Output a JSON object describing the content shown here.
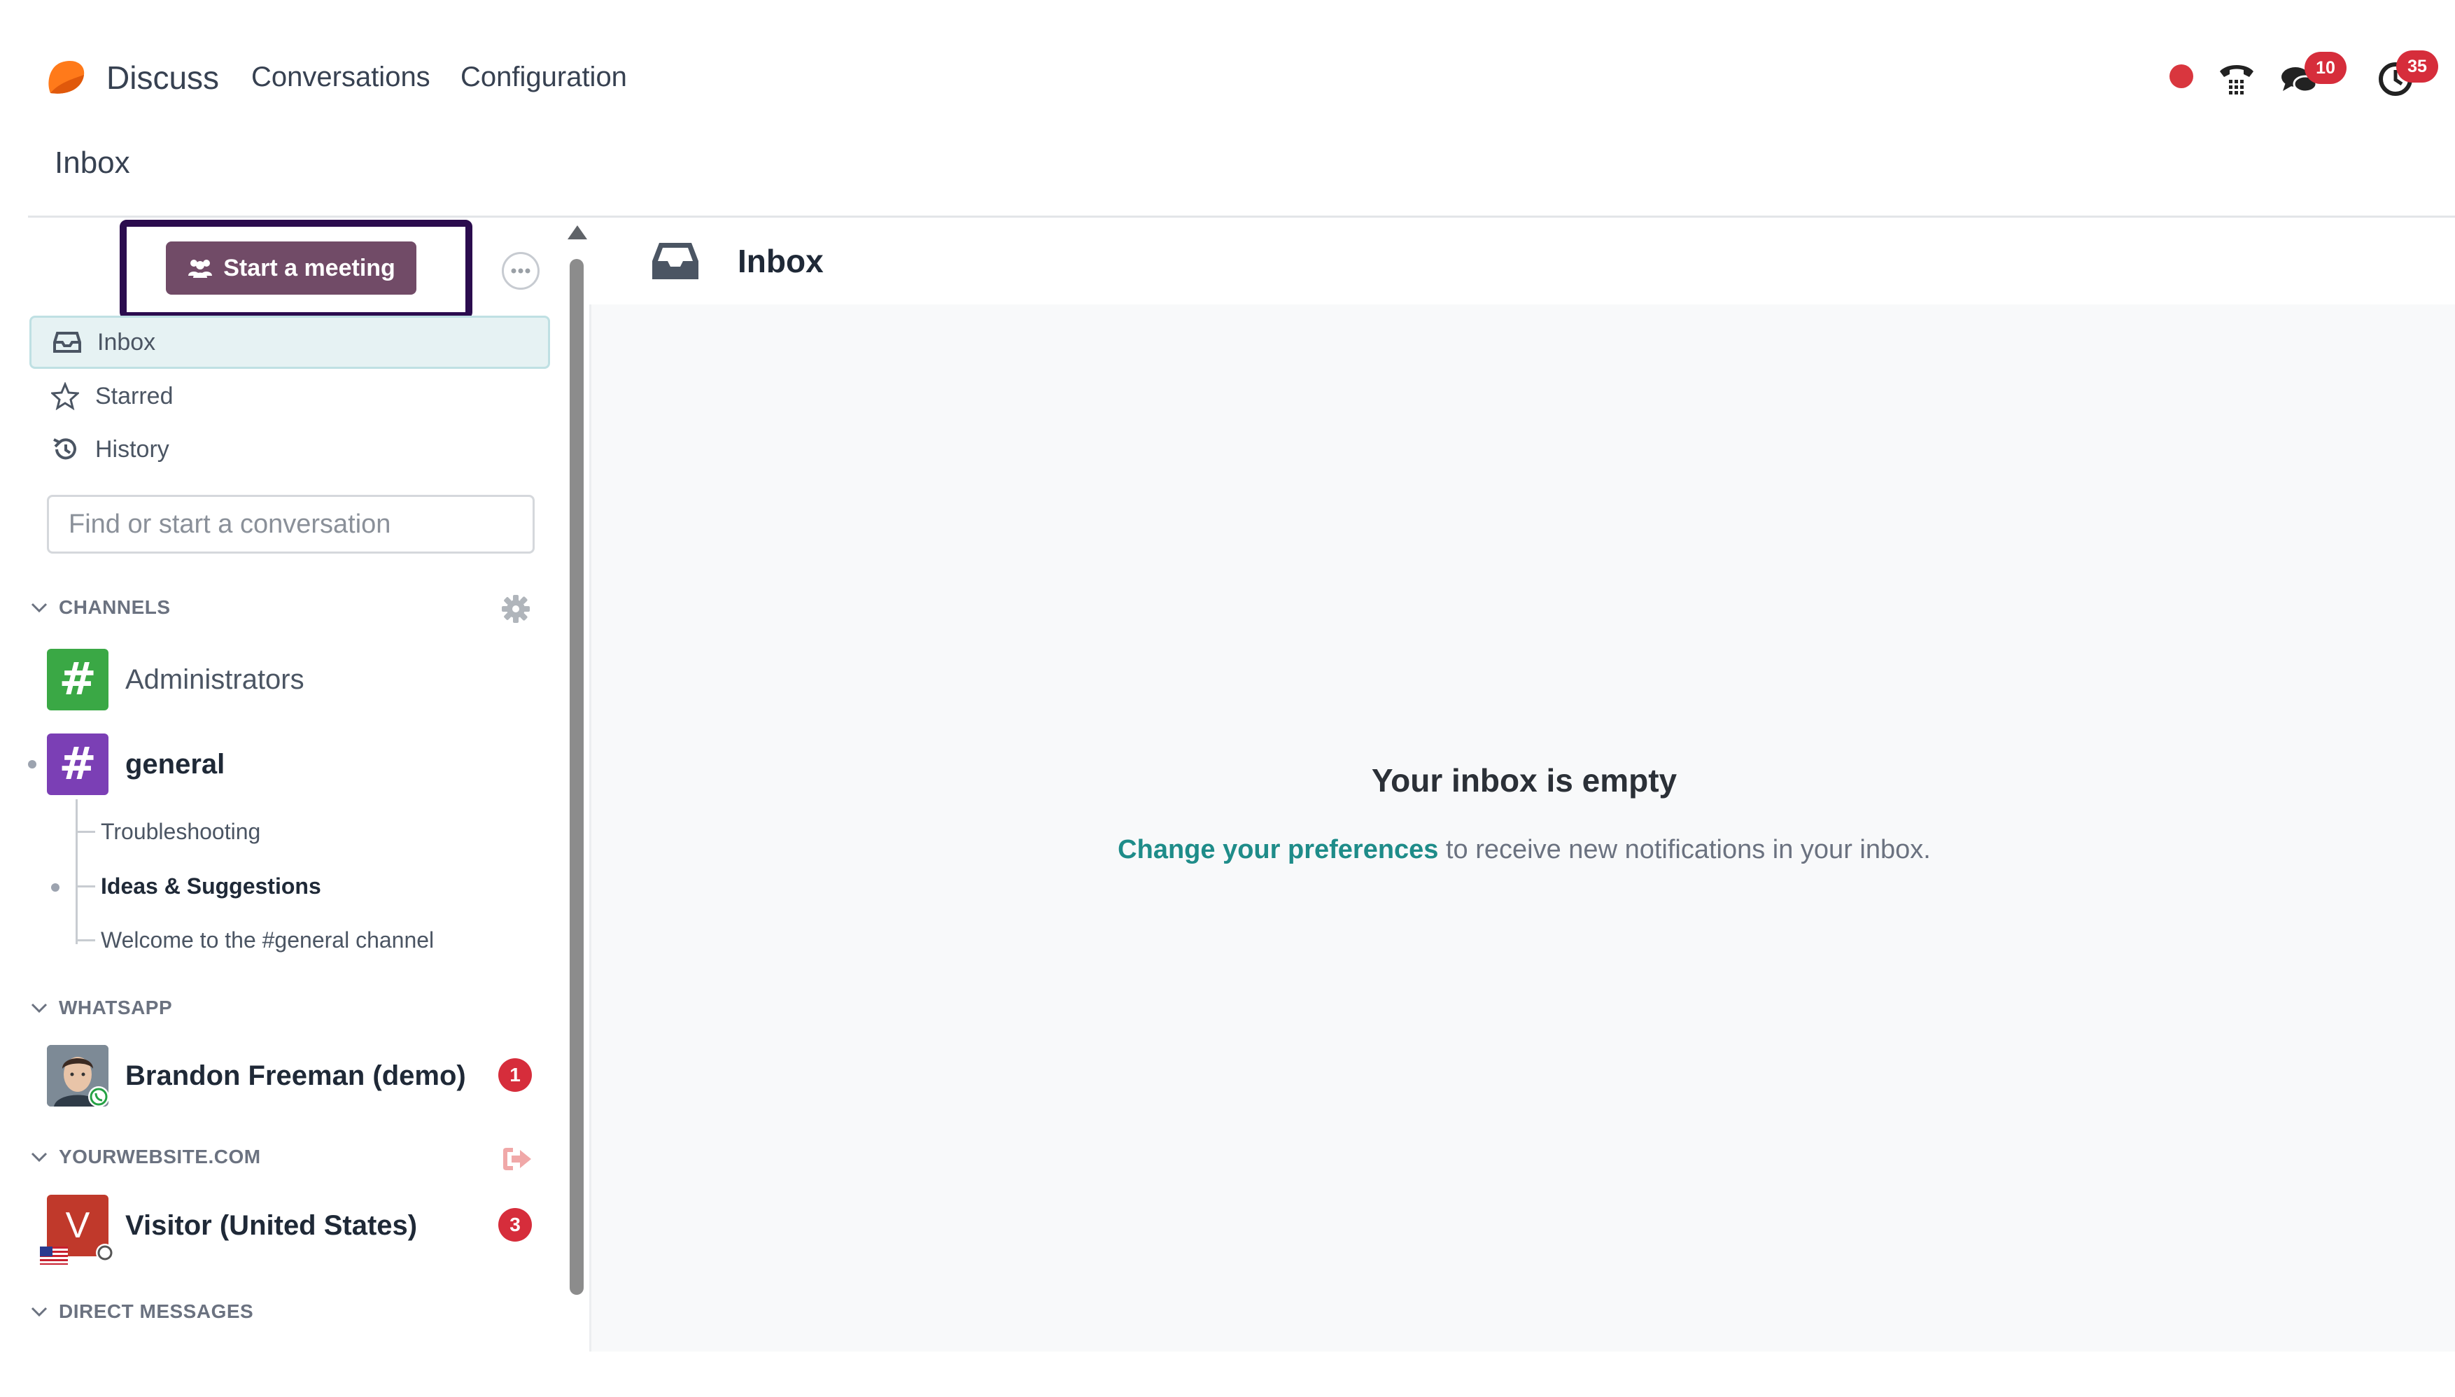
{
  "app": {
    "brand_name": "Discuss",
    "brand_color": "#ff7a1a"
  },
  "navbar": {
    "menu": [
      {
        "label": "Conversations"
      },
      {
        "label": "Configuration"
      }
    ],
    "system_tray": {
      "recording_dot_color": "#d9363e",
      "phone_icon": "phone-icon",
      "messages_icon": "chat-bubbles-icon",
      "messages_badge": "10",
      "activity_icon": "clock-icon",
      "activity_badge": "35"
    }
  },
  "breadcrumb": "Inbox",
  "sidebar": {
    "start_meeting_label": "Start a meeting",
    "mailboxes": [
      {
        "label": "Inbox",
        "icon": "inbox-icon",
        "active": true
      },
      {
        "label": "Starred",
        "icon": "star-icon",
        "active": false
      },
      {
        "label": "History",
        "icon": "history-icon",
        "active": false
      }
    ],
    "search": {
      "placeholder": "Find or start a conversation",
      "value": ""
    },
    "categories": {
      "channels": {
        "label": "CHANNELS"
      },
      "whatsapp": {
        "label": "WHATSAPP"
      },
      "website": {
        "label": "YOURWEBSITE.COM"
      },
      "direct": {
        "label": "DIRECT MESSAGES"
      }
    },
    "channels": [
      {
        "name": "Administrators",
        "color": "#3aa845",
        "glyph": "#"
      },
      {
        "name": "general",
        "color": "#7b3fb5",
        "glyph": "#",
        "unread": true
      }
    ],
    "sub_threads": [
      {
        "name": "Troubleshooting",
        "unread": false
      },
      {
        "name": "Ideas & Suggestions",
        "unread": true
      },
      {
        "name": "Welcome to the #general channel",
        "unread": false
      }
    ],
    "whatsapp_contacts": [
      {
        "name": "Brandon Freeman (demo)",
        "badge": "1"
      }
    ],
    "website_contacts": [
      {
        "name": "Visitor (United States)",
        "initial": "V",
        "badge": "3"
      }
    ]
  },
  "main": {
    "title": "Inbox",
    "empty_title": "Your inbox is empty",
    "empty_link": "Change your preferences",
    "empty_text": " to receive new notifications in your inbox."
  },
  "colors": {
    "accent": "#714b67",
    "link": "#1e8c89",
    "badge": "#d62d3b",
    "highlight_border": "#2b0c4e"
  }
}
